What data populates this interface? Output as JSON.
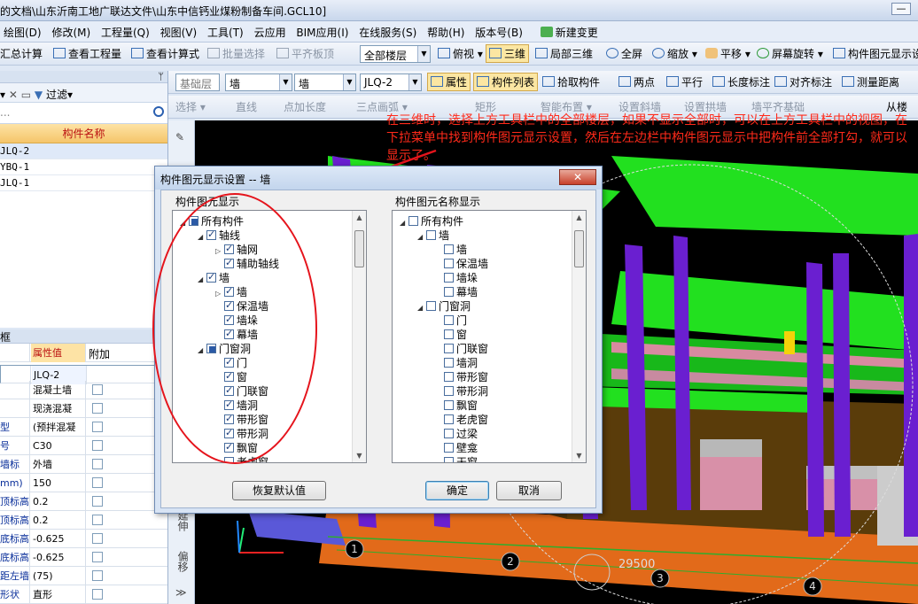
{
  "window": {
    "title": "的文档\\山东沂南工地广联达文件\\山东中信钙业煤粉制备车间.GCL10]",
    "minimize": "—"
  },
  "menu": [
    "绘图(D)",
    "修改(M)",
    "工程量(Q)",
    "视图(V)",
    "工具(T)",
    "云应用",
    "BIM应用(I)",
    "在线服务(S)",
    "帮助(H)",
    "版本号(B)"
  ],
  "menu_new_change": "新建变更",
  "toolbar1": {
    "summary": "汇总计算",
    "view_quantity": "查看工程量",
    "view_formula": "查看计算式",
    "batch_select": "批量选择",
    "flat_top": "平齐板顶",
    "floor_select": "全部楼层",
    "top_view": "俯视",
    "three_d": "三维",
    "local_3d": "局部三维",
    "fullscreen": "全屏",
    "zoom": "缩放",
    "pan": "平移",
    "screen_rotate": "屏幕旋转",
    "element_display": "构件图元显示设"
  },
  "toolbar2": {
    "layer": "基础层",
    "type1": "墙",
    "type2": "墙",
    "element": "JLQ-2",
    "property": "属性",
    "element_list": "构件列表",
    "pick_element": "拾取构件",
    "two_points": "两点",
    "parallel": "平行",
    "length_mark": "长度标注",
    "align_mark": "对齐标注",
    "measure": "测量距离"
  },
  "toolbar3": {
    "select": "选择",
    "line": "直线",
    "point_length": "点加长度",
    "three_point_arc": "三点画弧",
    "rectangle": "矩形",
    "smart_layout": "智能布置",
    "set_slope": "设置斜墙",
    "set_arch": "设置拱墙",
    "wall_flush": "墙平齐基础",
    "from_floor": "从楼"
  },
  "left_panel": {
    "pin": "ᛘ",
    "filter": "过滤",
    "search_placeholder": "...",
    "column_header": "构件名称",
    "rows": [
      "JLQ-2",
      "YBQ-1",
      "JLQ-1"
    ]
  },
  "props_panel": {
    "title": "框",
    "pin": "ᛘ",
    "col_value": "属性值",
    "col_extra": "附加",
    "rows": [
      {
        "name": "",
        "value": "JLQ-2"
      },
      {
        "name": "",
        "value": "混凝土墙"
      },
      {
        "name": "",
        "value": "现浇混凝"
      },
      {
        "name": "型",
        "value": "(预拌混凝"
      },
      {
        "name": "号",
        "value": "C30"
      },
      {
        "name": "墙标",
        "value": "外墙"
      },
      {
        "name": "mm)",
        "value": "150"
      },
      {
        "name": "顶标高",
        "value": "0.2"
      },
      {
        "name": "顶标高",
        "value": "0.2"
      },
      {
        "name": "底标高",
        "value": "-0.625"
      },
      {
        "name": "底标高",
        "value": "-0.625"
      },
      {
        "name": "距左墙",
        "value": "(75)"
      },
      {
        "name": "形状",
        "value": "直形"
      }
    ]
  },
  "vstrip": {
    "offset": "偏移",
    "extend": "延伸"
  },
  "annotation": "在三维时，选择上方工具栏中的全部楼层，如果不显示全部时，可以在上方工具栏中的视图，在下拉菜单中找到构件图元显示设置，然后在左边栏中构件图元显示中把构件前全部打勾，就可以显示了。",
  "viewport": {
    "dimension": "29500",
    "axis_labels": [
      "1",
      "2",
      "3",
      "4"
    ]
  },
  "dialog": {
    "title": "构件图元显示设置 -- 墙",
    "close": "✕",
    "left_group": "构件图元显示",
    "right_group": "构件图元名称显示",
    "left_tree": [
      {
        "label": "所有构件",
        "level": 0,
        "exp": "◢",
        "state": "part"
      },
      {
        "label": "轴线",
        "level": 1,
        "exp": "◢",
        "state": "on"
      },
      {
        "label": "轴网",
        "level": 2,
        "exp": "▷",
        "state": "on"
      },
      {
        "label": "辅助轴线",
        "level": 2,
        "exp": "",
        "state": "on"
      },
      {
        "label": "墙",
        "level": 1,
        "exp": "◢",
        "state": "on"
      },
      {
        "label": "墙",
        "level": 2,
        "exp": "▷",
        "state": "on"
      },
      {
        "label": "保温墙",
        "level": 2,
        "exp": "",
        "state": "on"
      },
      {
        "label": "墙垛",
        "level": 2,
        "exp": "",
        "state": "on"
      },
      {
        "label": "幕墙",
        "level": 2,
        "exp": "",
        "state": "on"
      },
      {
        "label": "门窗洞",
        "level": 1,
        "exp": "◢",
        "state": "part"
      },
      {
        "label": "门",
        "level": 2,
        "exp": "",
        "state": "on"
      },
      {
        "label": "窗",
        "level": 2,
        "exp": "",
        "state": "on"
      },
      {
        "label": "门联窗",
        "level": 2,
        "exp": "",
        "state": "on"
      },
      {
        "label": "墙洞",
        "level": 2,
        "exp": "",
        "state": "on"
      },
      {
        "label": "带形窗",
        "level": 2,
        "exp": "",
        "state": "on"
      },
      {
        "label": "带形洞",
        "level": 2,
        "exp": "",
        "state": "on"
      },
      {
        "label": "飘窗",
        "level": 2,
        "exp": "",
        "state": "on"
      },
      {
        "label": "老虎窗",
        "level": 2,
        "exp": "",
        "state": "off"
      }
    ],
    "right_tree": [
      {
        "label": "所有构件",
        "level": 0,
        "exp": "◢",
        "state": "off"
      },
      {
        "label": "墙",
        "level": 1,
        "exp": "◢",
        "state": "off"
      },
      {
        "label": "墙",
        "level": 2,
        "exp": "",
        "state": "off"
      },
      {
        "label": "保温墙",
        "level": 2,
        "exp": "",
        "state": "off"
      },
      {
        "label": "墙垛",
        "level": 2,
        "exp": "",
        "state": "off"
      },
      {
        "label": "幕墙",
        "level": 2,
        "exp": "",
        "state": "off"
      },
      {
        "label": "门窗洞",
        "level": 1,
        "exp": "◢",
        "state": "off"
      },
      {
        "label": "门",
        "level": 2,
        "exp": "",
        "state": "off"
      },
      {
        "label": "窗",
        "level": 2,
        "exp": "",
        "state": "off"
      },
      {
        "label": "门联窗",
        "level": 2,
        "exp": "",
        "state": "off"
      },
      {
        "label": "墙洞",
        "level": 2,
        "exp": "",
        "state": "off"
      },
      {
        "label": "带形窗",
        "level": 2,
        "exp": "",
        "state": "off"
      },
      {
        "label": "带形洞",
        "level": 2,
        "exp": "",
        "state": "off"
      },
      {
        "label": "飘窗",
        "level": 2,
        "exp": "",
        "state": "off"
      },
      {
        "label": "老虎窗",
        "level": 2,
        "exp": "",
        "state": "off"
      },
      {
        "label": "过梁",
        "level": 2,
        "exp": "",
        "state": "off"
      },
      {
        "label": "壁龛",
        "level": 2,
        "exp": "",
        "state": "off"
      },
      {
        "label": "天窗",
        "level": 2,
        "exp": "",
        "state": "off"
      }
    ],
    "restore_default": "恢复默认值",
    "ok": "确定",
    "cancel": "取消"
  },
  "colors": {
    "annotation": "#ff2a1a",
    "ellipse": "#e5141c",
    "slab_green": "#22e01f",
    "column_purple": "#6a1fd0",
    "wall_brown": "#5a3c0a"
  }
}
